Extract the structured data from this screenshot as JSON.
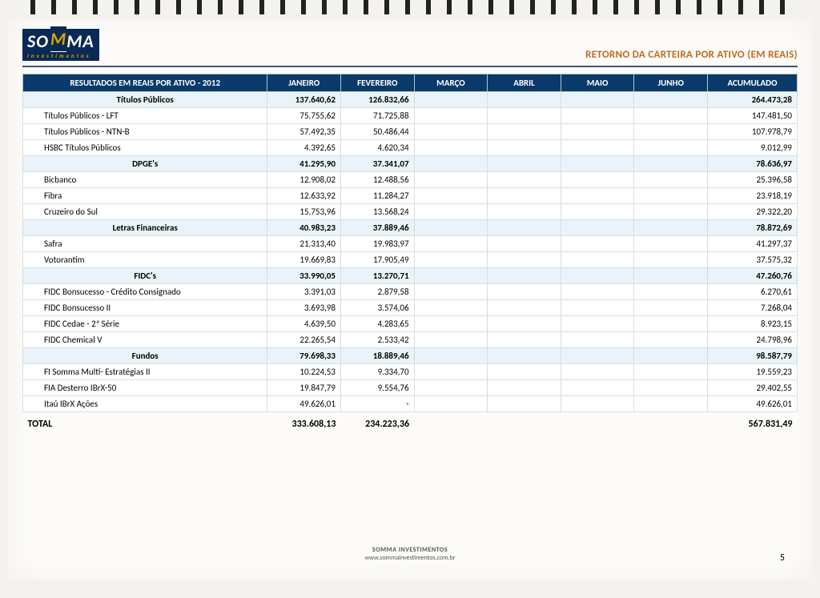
{
  "header": {
    "logo_main": "SOMMA",
    "logo_sub": "Investimentos",
    "right": "RETORNO DA CARTEIRA POR ATIVO (EM REAIS)"
  },
  "columns": {
    "title": "RESULTADOS EM REAIS POR ATIVO - 2012",
    "jan": "JANEIRO",
    "fev": "FEVEREIRO",
    "mar": "MARÇO",
    "abr": "ABRIL",
    "mai": "MAIO",
    "jun": "JUNHO",
    "acc": "ACUMULADO"
  },
  "groups": [
    {
      "name": "Títulos Públicos",
      "totals": {
        "jan": "137.640,62",
        "fev": "126.832,66",
        "mar": "",
        "abr": "",
        "mai": "",
        "jun": "",
        "acc": "264.473,28"
      },
      "rows": [
        {
          "label": "Títulos Públicos - LFT",
          "jan": "75.755,62",
          "fev": "71.725,88",
          "acc": "147.481,50"
        },
        {
          "label": "Títulos Públicos - NTN-B",
          "jan": "57.492,35",
          "fev": "50.486,44",
          "acc": "107.978,79"
        },
        {
          "label": "HSBC Títulos Públicos",
          "jan": "4.392,65",
          "fev": "4.620,34",
          "acc": "9.012,99"
        }
      ]
    },
    {
      "name": "DPGE's",
      "totals": {
        "jan": "41.295,90",
        "fev": "37.341,07",
        "acc": "78.636,97"
      },
      "rows": [
        {
          "label": "Bicbanco",
          "jan": "12.908,02",
          "fev": "12.488,56",
          "acc": "25.396,58"
        },
        {
          "label": "Fibra",
          "jan": "12.633,92",
          "fev": "11.284,27",
          "acc": "23.918,19"
        },
        {
          "label": "Cruzeiro do Sul",
          "jan": "15.753,96",
          "fev": "13.568,24",
          "acc": "29.322,20"
        }
      ]
    },
    {
      "name": "Letras Financeiras",
      "totals": {
        "jan": "40.983,23",
        "fev": "37.889,46",
        "acc": "78.872,69"
      },
      "rows": [
        {
          "label": "Safra",
          "jan": "21.313,40",
          "fev": "19.983,97",
          "acc": "41.297,37"
        },
        {
          "label": "Votorantim",
          "jan": "19.669,83",
          "fev": "17.905,49",
          "acc": "37.575,32"
        }
      ]
    },
    {
      "name": "FIDC's",
      "totals": {
        "jan": "33.990,05",
        "fev": "13.270,71",
        "acc": "47.260,76"
      },
      "rows": [
        {
          "label": "FIDC Bonsucesso - Crédito Consignado",
          "jan": "3.391,03",
          "fev": "2.879,58",
          "acc": "6.270,61"
        },
        {
          "label": "FIDC Bonsucesso II",
          "jan": "3.693,98",
          "fev": "3.574,06",
          "acc": "7.268,04"
        },
        {
          "label": "FIDC Cedae - 2ª Série",
          "jan": "4.639,50",
          "fev": "4.283,65",
          "acc": "8.923,15"
        },
        {
          "label": "FIDC Chemical V",
          "jan": "22.265,54",
          "fev": "2.533,42",
          "acc": "24.798,96"
        }
      ]
    },
    {
      "name": "Fundos",
      "totals": {
        "jan": "79.698,33",
        "fev": "18.889,46",
        "acc": "98.587,79"
      },
      "rows": [
        {
          "label": "FI Somma Multi- Estratégias II",
          "jan": "10.224,53",
          "fev": "9.334,70",
          "acc": "19.559,23"
        },
        {
          "label": "FIA Desterro IBrX-50",
          "jan": "19.847,79",
          "fev": "9.554,76",
          "acc": "29.402,55"
        },
        {
          "label": "Itaú IBrX Ações",
          "jan": "49.626,01",
          "fev": "-",
          "acc": "49.626,01"
        }
      ]
    }
  ],
  "grand_total": {
    "label": "TOTAL",
    "jan": "333.608,13",
    "fev": "234.223,36",
    "acc": "567.831,49"
  },
  "footer": {
    "line1": "SOMMA INVESTIMENTOS",
    "line2": "www.sommainvestimentos.com.br",
    "page": "5"
  }
}
